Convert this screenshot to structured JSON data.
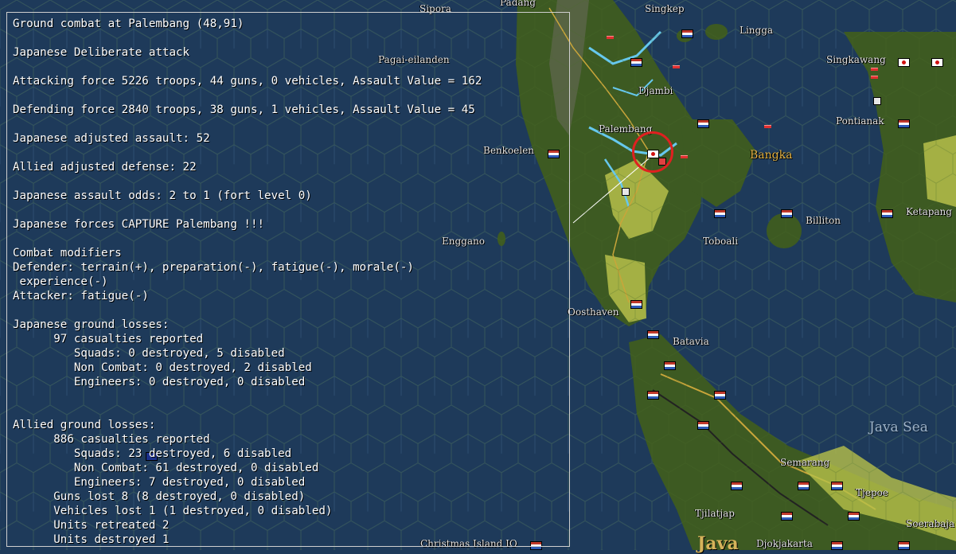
{
  "report": {
    "lines": [
      "Ground combat at Palembang (48,91)",
      "",
      "Japanese Deliberate attack",
      "",
      "Attacking force 5226 troops, 44 guns, 0 vehicles, Assault Value = 162",
      "",
      "Defending force 2840 troops, 38 guns, 1 vehicles, Assault Value = 45",
      "",
      "Japanese adjusted assault: 52",
      "",
      "Allied adjusted defense: 22",
      "",
      "Japanese assault odds: 2 to 1 (fort level 0)",
      "",
      "Japanese forces CAPTURE Palembang !!!",
      "",
      "Combat modifiers",
      "Defender: terrain(+), preparation(-), fatigue(-), morale(-)",
      " experience(-)",
      "Attacker: fatigue(-)",
      "",
      "Japanese ground losses:",
      "      97 casualties reported",
      "         Squads: 0 destroyed, 5 disabled",
      "         Non Combat: 0 destroyed, 2 disabled",
      "         Engineers: 0 destroyed, 0 disabled",
      "",
      "",
      "Allied ground losses:",
      "      886 casualties reported",
      "         Squads: 23 destroyed, 6 disabled",
      "         Non Combat: 61 destroyed, 0 disabled",
      "         Engineers: 7 destroyed, 0 disabled",
      "      Guns lost 8 (8 destroyed, 0 disabled)",
      "      Vehicles lost 1 (1 destroyed, 0 disabled)",
      "      Units retreated 2",
      "      Units destroyed 1"
    ]
  },
  "map": {
    "labels": {
      "sipora": "Sipora",
      "padang": "Padang",
      "singkep": "Singkep",
      "lingga": "Lingga",
      "pagai": "Pagai-eilanden",
      "singkawang": "Singkawang",
      "djambi": "Djambi",
      "pontianak": "Pontianak",
      "palembang": "Palembang",
      "bangka": "Bangka",
      "benkoelen": "Benkoelen",
      "billiton": "Billiton",
      "ketapang": "Ketapang",
      "toboali": "Toboali",
      "enggano": "Enggano",
      "oosthaven": "Oosthaven",
      "batavia": "Batavia",
      "java_sea": "Java Sea",
      "semarang": "Semarang",
      "tjepoe": "Tjepoe",
      "tjilatjap": "Tjilatjap",
      "soerabaja": "Soerabaja",
      "djokjakarta": "Djokjakarta",
      "christmas": "Christmas Island IO",
      "java": "Java"
    }
  },
  "colors": {
    "sea": "#1e3a5a",
    "hex_line": "#2d4d70",
    "land_forest": "#3d5a22",
    "land_clear": "#b6c04a",
    "river": "#66c8ee",
    "selection": "#e02020",
    "text": "#ffffff"
  }
}
